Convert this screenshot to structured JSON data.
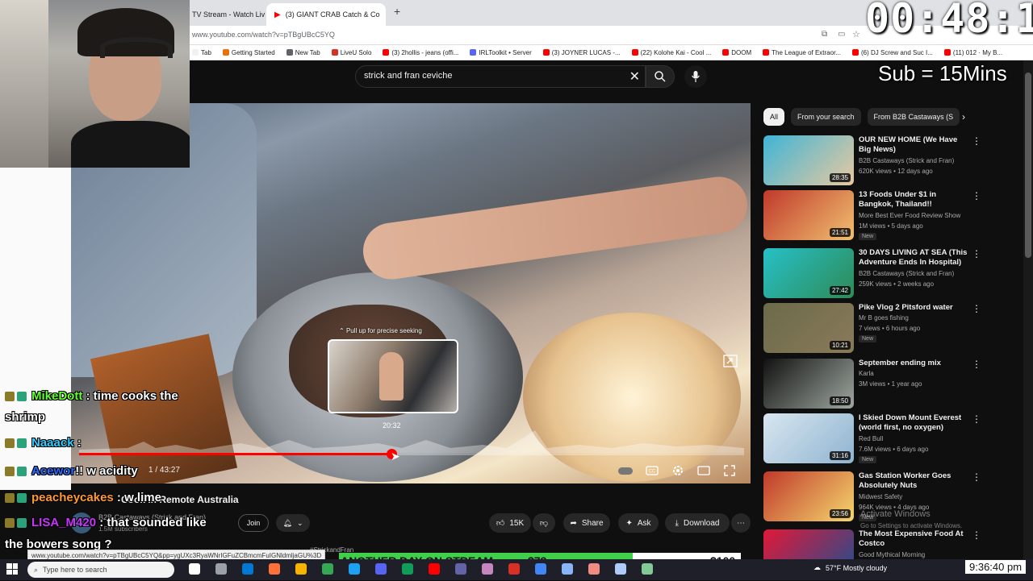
{
  "browser": {
    "tabs": [
      {
        "label": "TV Stream - Watch Liv",
        "active": false
      },
      {
        "label": "(3) GIANT CRAB Catch & Co",
        "active": true
      }
    ],
    "new_tab": "+",
    "url": "www.youtube.com/watch?v=pTBgUBcC5YQ",
    "bookmarks": [
      {
        "label": "Tab",
        "color": "#f1f1f1"
      },
      {
        "label": "Getting Started",
        "color": "#e8710a"
      },
      {
        "label": "New Tab",
        "color": "#5f6368"
      },
      {
        "label": "LiveU Solo",
        "color": "#d93025"
      },
      {
        "label": "(3) 2hollis - jeans (offi...",
        "color": "#ff0000"
      },
      {
        "label": "IRLToolkit • Server",
        "color": "#5865f2"
      },
      {
        "label": "(3) JOYNER LUCAS -...",
        "color": "#ff0000"
      },
      {
        "label": "(22) Kolohe Kai - Cool ...",
        "color": "#ff0000"
      },
      {
        "label": "DOOM",
        "color": "#ff0000"
      },
      {
        "label": "The League of Extraor...",
        "color": "#ff0000"
      },
      {
        "label": "(6) DJ Screw and Suc I...",
        "color": "#ff0000"
      },
      {
        "label": "(11) 012 · My B...",
        "color": "#ff0000"
      }
    ]
  },
  "youtube": {
    "search_value": "strick and fran ceviche",
    "video": {
      "preview_hint": "Pull up for precise seeking",
      "preview_time": "20:32",
      "time_display": "1 / 43:27",
      "progress_fraction": 0.47,
      "title": "Cook In Remote Australia",
      "channel": "B2B Castaways (Strick and Fran)",
      "subscribers": "1.5M subscribers",
      "description_snippet": "#StrickandFran"
    },
    "actions": {
      "join": "Join",
      "likes": "15K",
      "share": "Share",
      "ask": "Ask",
      "download": "Download"
    },
    "chips": [
      {
        "label": "All",
        "active": true
      },
      {
        "label": "From your search",
        "active": false
      },
      {
        "label": "From B2B Castaways (S",
        "active": false
      }
    ],
    "recommendations": [
      {
        "title": "OUR NEW HOME (We Have Big News)",
        "channel": "B2B Castaways (Strick and Fran)",
        "meta": "620K views • 12 days ago",
        "duration": "28:35",
        "badge": "",
        "thumb_a": "#3fb4d6",
        "thumb_b": "#e8c9a0"
      },
      {
        "title": "13 Foods Under $1 in Bangkok, Thailand!!",
        "channel": "More Best Ever Food Review Show",
        "meta": "1M views • 5 days ago",
        "duration": "21:51",
        "badge": "New",
        "thumb_a": "#c0392b",
        "thumb_b": "#f0c070"
      },
      {
        "title": "30 DAYS LIVING AT SEA (This Adventure Ends In Hospital)",
        "channel": "B2B Castaways (Strick and Fran)",
        "meta": "259K views • 2 weeks ago",
        "duration": "27:42",
        "badge": "",
        "thumb_a": "#26c0c7",
        "thumb_b": "#2e8b57"
      },
      {
        "title": "Pike Vlog 2 Pitsford water",
        "channel": "Mr B goes fishing",
        "meta": "7 views • 6 hours ago",
        "duration": "10:21",
        "badge": "New",
        "thumb_a": "#6b6b4a",
        "thumb_b": "#8a7a5a"
      },
      {
        "title": "September ending mix",
        "channel": "Karla",
        "meta": "3M views • 1 year ago",
        "duration": "18:50",
        "badge": "",
        "thumb_a": "#111111",
        "thumb_b": "#9fa8a0"
      },
      {
        "title": "I Skied Down Mount Everest (world first, no oxygen)",
        "channel": "Red Bull",
        "meta": "7.6M views • 6 days ago",
        "duration": "31:16",
        "badge": "New",
        "thumb_a": "#d8e6f0",
        "thumb_b": "#8fb4d0"
      },
      {
        "title": "Gas Station Worker Goes Absolutely Nuts",
        "channel": "Midwest Safety",
        "meta": "964K views • 4 days ago",
        "duration": "23:56",
        "badge": "New",
        "thumb_a": "#c0392b",
        "thumb_b": "#f5d76e"
      },
      {
        "title": "The Most Expensive Food At Costco",
        "channel": "Good Mythical Morning",
        "meta": "",
        "duration": "",
        "badge": "",
        "thumb_a": "#e31837",
        "thumb_b": "#1d4f91"
      }
    ]
  },
  "overlay": {
    "timer": "00:48:14",
    "sub_label": "Sub = 15Mins",
    "chat": [
      {
        "user": "MikeDott",
        "user_color": "#66ff33",
        "message": " : time cooks the"
      },
      {
        "user": "",
        "user_color": "#ffffff",
        "message": "shrimp"
      },
      {
        "user": "Naaack",
        "user_color": "#33ccff",
        "message": " :"
      },
      {
        "user": "Acewor",
        "user_color": "#2a6cff",
        "message": "!! w acidity"
      },
      {
        "user": "peacheycakes",
        "user_color": "#ff9933",
        "message": " : w lime"
      },
      {
        "user": "LISA_M420",
        "user_color": "#cc33ff",
        "message": " : that sounded like"
      },
      {
        "user": "",
        "user_color": "#ffffff",
        "message": "the bowers song ?"
      }
    ],
    "goal": {
      "label": "ANOTHER DAY ON STREAM",
      "current": "$73",
      "target": "$100",
      "fraction": 0.73
    }
  },
  "status_url": "www.youtube.com/watch?v=pTBgUBcC5YQ&pp=ygUXc3RyaWNrIGFuZCBmcmFuIGNldmljaGU%3D",
  "windows": {
    "activate_title": "Activate Windows",
    "activate_sub": "Go to Settings to activate Windows.",
    "search_placeholder": "Type here to search",
    "weather": "57°F  Mostly cloudy",
    "clock": "9:36:40 pm"
  }
}
